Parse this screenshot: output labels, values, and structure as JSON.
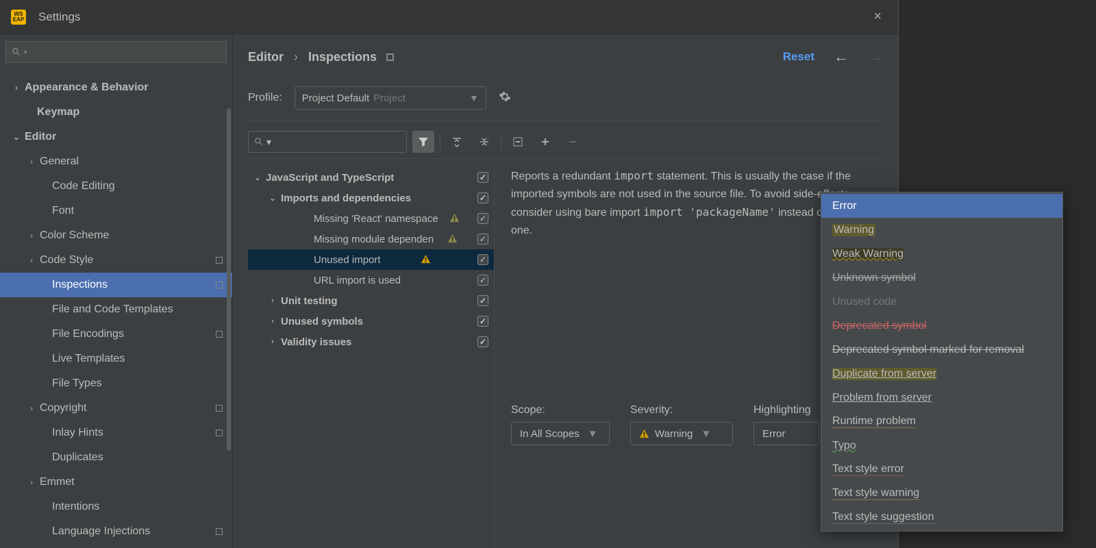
{
  "title": "Settings",
  "close_label": "×",
  "sidebar": {
    "items": [
      {
        "label": "Appearance & Behavior",
        "indent": 18,
        "chev": "›",
        "bold": true
      },
      {
        "label": "Keymap",
        "indent": 36,
        "chev": "",
        "bold": true
      },
      {
        "label": "Editor",
        "indent": 18,
        "chev": "⌄",
        "bold": true
      },
      {
        "label": "General",
        "indent": 40,
        "chev": "›",
        "bold": false
      },
      {
        "label": "Code Editing",
        "indent": 58,
        "chev": "",
        "bold": false
      },
      {
        "label": "Font",
        "indent": 58,
        "chev": "",
        "bold": false
      },
      {
        "label": "Color Scheme",
        "indent": 40,
        "chev": "›",
        "bold": false
      },
      {
        "label": "Code Style",
        "indent": 40,
        "chev": "›",
        "bold": false,
        "badge": true
      },
      {
        "label": "Inspections",
        "indent": 58,
        "chev": "",
        "bold": false,
        "selected": true,
        "badge": true
      },
      {
        "label": "File and Code Templates",
        "indent": 58,
        "chev": "",
        "bold": false
      },
      {
        "label": "File Encodings",
        "indent": 58,
        "chev": "",
        "bold": false,
        "badge": true
      },
      {
        "label": "Live Templates",
        "indent": 58,
        "chev": "",
        "bold": false
      },
      {
        "label": "File Types",
        "indent": 58,
        "chev": "",
        "bold": false
      },
      {
        "label": "Copyright",
        "indent": 40,
        "chev": "›",
        "bold": false,
        "badge": true
      },
      {
        "label": "Inlay Hints",
        "indent": 58,
        "chev": "",
        "bold": false,
        "badge": true
      },
      {
        "label": "Duplicates",
        "indent": 58,
        "chev": "",
        "bold": false
      },
      {
        "label": "Emmet",
        "indent": 40,
        "chev": "›",
        "bold": false
      },
      {
        "label": "Intentions",
        "indent": 58,
        "chev": "",
        "bold": false
      },
      {
        "label": "Language Injections",
        "indent": 58,
        "chev": "",
        "bold": false,
        "badge": true
      }
    ]
  },
  "breadcrumb": {
    "a": "Editor",
    "b": "Inspections"
  },
  "reset_label": "Reset",
  "profile": {
    "label": "Profile:",
    "value": "Project Default",
    "scope": "Project"
  },
  "inspections": {
    "rows": [
      {
        "label": "JavaScript and TypeScript",
        "indent": 8,
        "chev": "⌄",
        "bold": true,
        "checked": true
      },
      {
        "label": "Imports and dependencies",
        "indent": 30,
        "chev": "⌄",
        "bold": true,
        "checked": true
      },
      {
        "label": "Missing 'React' namespace",
        "indent": 78,
        "chev": "",
        "bold": false,
        "checked": true,
        "warn": "lo"
      },
      {
        "label": "Missing module dependen",
        "indent": 78,
        "chev": "",
        "bold": false,
        "checked": true,
        "warn": "lo"
      },
      {
        "label": "Unused import",
        "indent": 78,
        "chev": "",
        "bold": false,
        "checked": true,
        "warn": "hi",
        "selected": true
      },
      {
        "label": "URL import is used",
        "indent": 78,
        "chev": "",
        "bold": false,
        "checked": true
      },
      {
        "label": "Unit testing",
        "indent": 30,
        "chev": "›",
        "bold": true,
        "checked": true
      },
      {
        "label": "Unused symbols",
        "indent": 30,
        "chev": "›",
        "bold": true,
        "checked": true
      },
      {
        "label": "Validity issues",
        "indent": 30,
        "chev": "›",
        "bold": true,
        "checked": true
      }
    ]
  },
  "description": {
    "t1": "Reports a redundant ",
    "c1": "import",
    "t2": " statement. This is usually the case if the imported symbols are not used in the source file. To avoid side-effects, consider using bare import ",
    "c2": "import 'packageName'",
    "t3": " instead of the regular one."
  },
  "bottom": {
    "scope_label": "Scope:",
    "scope_value": "In All Scopes",
    "sev_label": "Severity:",
    "sev_value": "Warning",
    "hl_label": "Highlighting",
    "hl_value": "Error"
  },
  "popup": [
    {
      "label": "Error",
      "cls": "sel"
    },
    {
      "label": "Warning",
      "cls": "warn"
    },
    {
      "label": "Weak Warning",
      "cls": "weak"
    },
    {
      "label": "Unknown symbol",
      "cls": "unk"
    },
    {
      "label": "Unused code",
      "cls": "unused"
    },
    {
      "label": "Deprecated symbol",
      "cls": "depr"
    },
    {
      "label": "Deprecated symbol marked for removal",
      "cls": "depr2"
    },
    {
      "label": "Duplicate from server",
      "cls": "dup"
    },
    {
      "label": "Problem from server",
      "cls": "prob"
    },
    {
      "label": "Runtime problem",
      "cls": "runtime"
    },
    {
      "label": "Typo",
      "cls": "typo"
    },
    {
      "label": "Text style error",
      "cls": "tse"
    },
    {
      "label": "Text style warning",
      "cls": "tsw"
    },
    {
      "label": "Text style suggestion",
      "cls": "tss"
    }
  ]
}
